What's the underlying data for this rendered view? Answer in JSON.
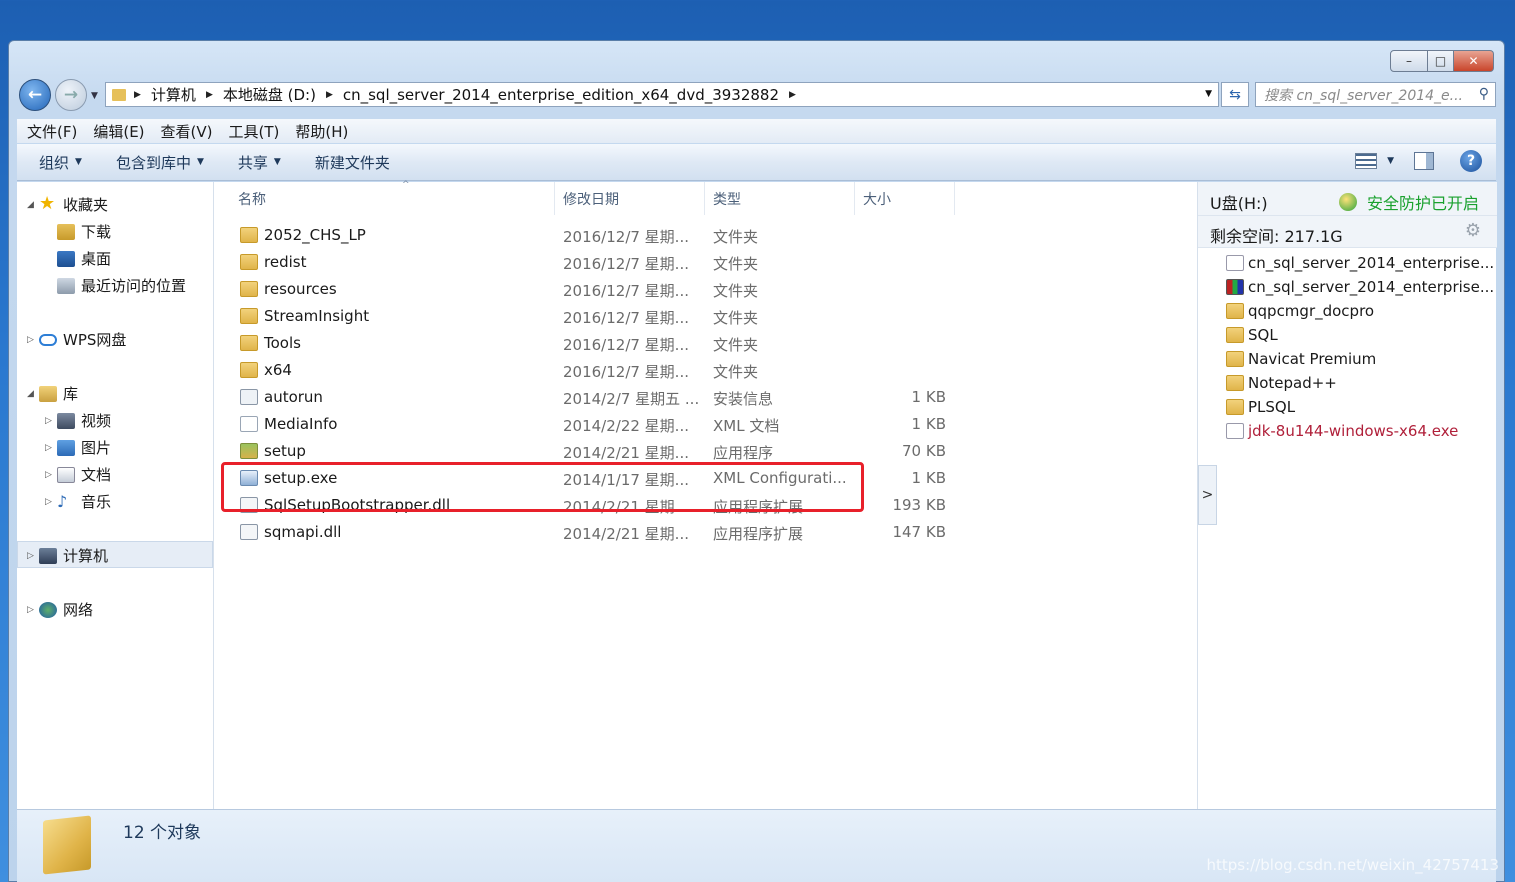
{
  "window": {
    "caption_buttons": {
      "minimize": "–",
      "maximize": "□",
      "close": "✕"
    }
  },
  "address_bar": {
    "crumbs": [
      "计算机",
      "本地磁盘 (D:)",
      "cn_sql_server_2014_enterprise_edition_x64_dvd_3932882"
    ],
    "search_placeholder": "搜索 cn_sql_server_2014_e..."
  },
  "menu": [
    "文件(F)",
    "编辑(E)",
    "查看(V)",
    "工具(T)",
    "帮助(H)"
  ],
  "toolbar": {
    "organize": "组织",
    "include_library": "包含到库中",
    "share": "共享",
    "new_folder": "新建文件夹"
  },
  "nav": {
    "favorites": "收藏夹",
    "downloads": "下载",
    "desktop": "桌面",
    "recent": "最近访问的位置",
    "wps": "WPS网盘",
    "libraries": "库",
    "videos": "视频",
    "pictures": "图片",
    "documents": "文档",
    "music": "音乐",
    "computer": "计算机",
    "network": "网络"
  },
  "columns": {
    "name": "名称",
    "date": "修改日期",
    "type": "类型",
    "size": "大小"
  },
  "files": [
    {
      "name": "2052_CHS_LP",
      "date": "2016/12/7 星期...",
      "type": "文件夹",
      "size": "",
      "icon": "folder"
    },
    {
      "name": "redist",
      "date": "2016/12/7 星期...",
      "type": "文件夹",
      "size": "",
      "icon": "folder"
    },
    {
      "name": "resources",
      "date": "2016/12/7 星期...",
      "type": "文件夹",
      "size": "",
      "icon": "folder"
    },
    {
      "name": "StreamInsight",
      "date": "2016/12/7 星期...",
      "type": "文件夹",
      "size": "",
      "icon": "folder"
    },
    {
      "name": "Tools",
      "date": "2016/12/7 星期...",
      "type": "文件夹",
      "size": "",
      "icon": "folder"
    },
    {
      "name": "x64",
      "date": "2016/12/7 星期...",
      "type": "文件夹",
      "size": "",
      "icon": "folder"
    },
    {
      "name": "autorun",
      "date": "2014/2/7 星期五 ...",
      "type": "安装信息",
      "size": "1 KB",
      "icon": "inf"
    },
    {
      "name": "MediaInfo",
      "date": "2014/2/22 星期...",
      "type": "XML 文档",
      "size": "1 KB",
      "icon": "xml"
    },
    {
      "name": "setup",
      "date": "2014/2/21 星期...",
      "type": "应用程序",
      "size": "70 KB",
      "icon": "setup"
    },
    {
      "name": "setup.exe",
      "date": "2014/1/17 星期...",
      "type": "XML Configurati...",
      "size": "1 KB",
      "icon": "exe"
    },
    {
      "name": "SqlSetupBootstrapper.dll",
      "date": "2014/2/21 星期...",
      "type": "应用程序扩展",
      "size": "193 KB",
      "icon": "dll"
    },
    {
      "name": "sqmapi.dll",
      "date": "2014/2/21 星期...",
      "type": "应用程序扩展",
      "size": "147 KB",
      "icon": "dll"
    }
  ],
  "preview": {
    "drive": "U盘(H:)",
    "protection": "安全防护已开启",
    "free_space": "剩余空间: 217.1G",
    "items": [
      {
        "name": "cn_sql_server_2014_enterprise...",
        "icon": "sql"
      },
      {
        "name": "cn_sql_server_2014_enterprise...",
        "icon": "rar"
      },
      {
        "name": "qqpcmgr_docpro",
        "icon": "folder"
      },
      {
        "name": "SQL",
        "icon": "folder"
      },
      {
        "name": "Navicat Premium",
        "icon": "folder"
      },
      {
        "name": "Notepad++",
        "icon": "folder"
      },
      {
        "name": "PLSQL",
        "icon": "folder"
      },
      {
        "name": "jdk-8u144-windows-x64.exe",
        "icon": "jdk"
      }
    ]
  },
  "status": {
    "count": "12 个对象"
  },
  "watermark": "https://blog.csdn.net/weixin_42757413",
  "colors": {
    "highlight": "#e8202a",
    "jdk_text": "#b0203a",
    "safe_green": "#1aa12e"
  }
}
